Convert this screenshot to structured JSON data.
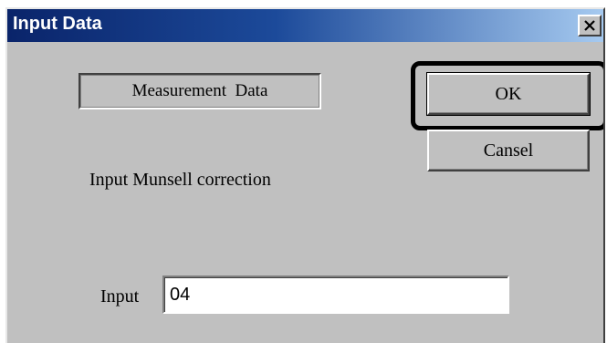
{
  "window": {
    "title": "Input Data",
    "titlebar_colors": [
      "#0a246a",
      "#a6caf0"
    ],
    "close_icon": "close-x-icon"
  },
  "measurement": {
    "label": "Measurement  Data"
  },
  "buttons": {
    "ok_label": "OK",
    "cancel_label": "Cansel",
    "highlight_color": "#000000"
  },
  "prompt": {
    "text": "Input Munsell correction"
  },
  "input": {
    "label": "Input",
    "value": "04"
  }
}
